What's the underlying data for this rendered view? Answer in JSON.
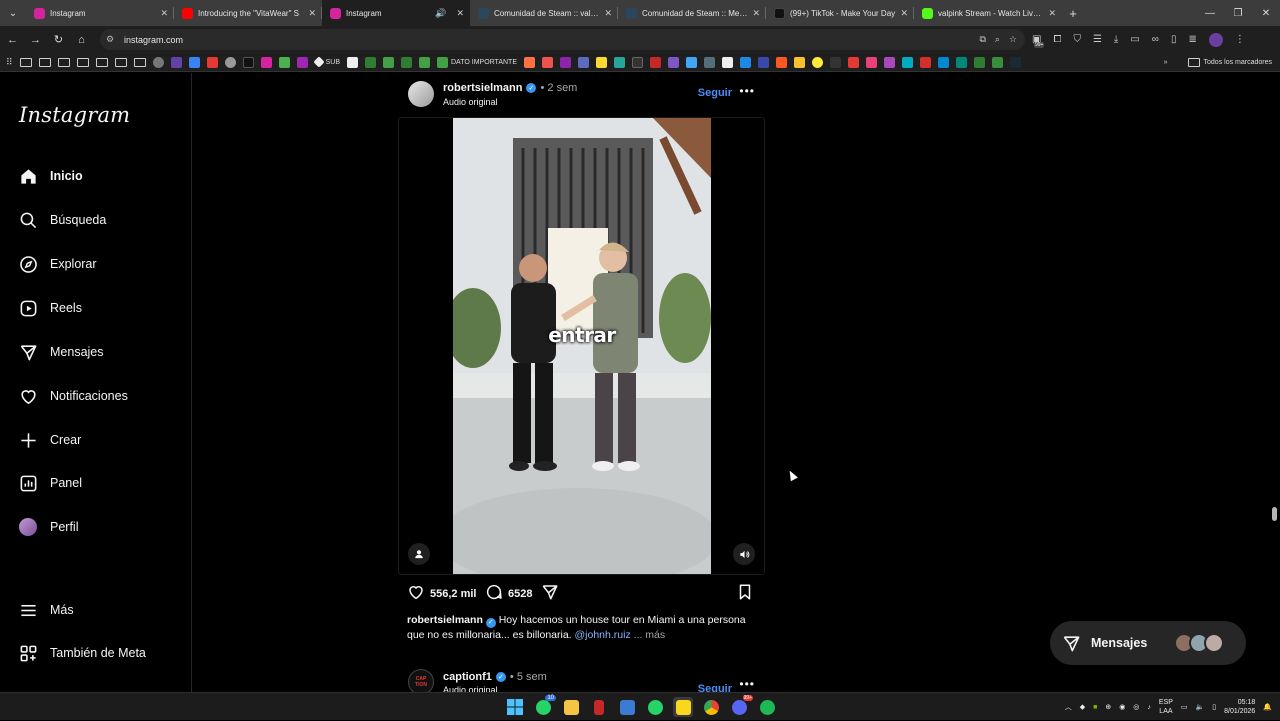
{
  "browser": {
    "tabs": [
      {
        "label": "Instagram",
        "favicon_color": "#d6249f",
        "active": false
      },
      {
        "label": "Introducing the \"VitaWear\" S",
        "favicon_color": "#ff0000",
        "active": false
      },
      {
        "label": "Instagram",
        "favicon_color": "#d6249f",
        "active": true
      },
      {
        "label": "Comunidad de Steam :: valpink",
        "favicon_color": "#1b2838",
        "active": false
      },
      {
        "label": "Comunidad de Steam :: Mercad",
        "favicon_color": "#1b2838",
        "active": false
      },
      {
        "label": "(99+) TikTok - Make Your Day",
        "favicon_color": "#111111",
        "active": false
      },
      {
        "label": "valpink Stream - Watch Live on",
        "favicon_color": "#53fc18",
        "active": false
      }
    ],
    "url": "instagram.com",
    "bookmarks": {
      "sub_label": "SUB",
      "dato_label": "DATO IMPORTANTE",
      "all_label": "Todos los marcadores"
    },
    "extension_badge": "99+"
  },
  "instagram": {
    "logo": "Instagram",
    "nav": [
      {
        "label": "Inicio",
        "icon": "home-icon"
      },
      {
        "label": "Búsqueda",
        "icon": "search-icon"
      },
      {
        "label": "Explorar",
        "icon": "compass-icon"
      },
      {
        "label": "Reels",
        "icon": "reels-icon"
      },
      {
        "label": "Mensajes",
        "icon": "messenger-icon"
      },
      {
        "label": "Notificaciones",
        "icon": "heart-icon"
      },
      {
        "label": "Crear",
        "icon": "plus-icon"
      },
      {
        "label": "Panel",
        "icon": "chart-icon"
      },
      {
        "label": "Perfil",
        "icon": "avatar"
      }
    ],
    "more_label": "Más",
    "meta_label": "También de Meta",
    "post": {
      "username": "robertsielmann",
      "time": "2 sem",
      "audio": "Audio original",
      "follow": "Seguir",
      "video_overlay_text": "entrar",
      "likes": "556,2 mil",
      "comments": "6528",
      "caption_text": "Hoy hacemos un house tour en Miami a una persona que no es millonaria... es billonaria.",
      "caption_mention": "@johnh.ruiz",
      "caption_more": "... más"
    },
    "post2": {
      "username": "captionf1",
      "time": "5 sem",
      "audio": "Audio original",
      "follow": "Seguir",
      "avatar_text": "CAP TION"
    },
    "messages_pill": "Mensajes"
  },
  "taskbar": {
    "lang_line1": "ESP",
    "lang_line2": "LAA",
    "time": "05:18",
    "date": "8/01/2026",
    "whatsapp_badge": "10",
    "discord_badge": "99+"
  }
}
